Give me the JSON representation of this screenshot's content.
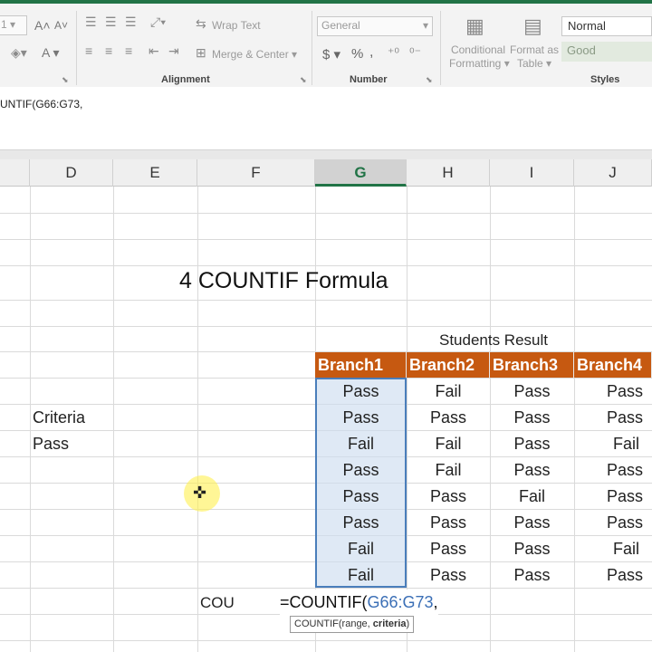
{
  "ribbon": {
    "wrap_text": "Wrap Text",
    "merge_center": "Merge & Center",
    "number_format": "General",
    "currency": "$",
    "percent": "%",
    "comma": ",",
    "conditional_formatting": [
      "Conditional",
      "Formatting"
    ],
    "format_as_table": [
      "Format as",
      "Table"
    ],
    "style_normal": "Normal",
    "style_good": "Good",
    "group_alignment": "Alignment",
    "group_number": "Number",
    "group_styles": "Styles",
    "font_grow": "A",
    "font_shrink": "A",
    "font_color": "A",
    "font_size_value": "1"
  },
  "formula_bar": {
    "text": "UNTIF(G66:G73,"
  },
  "columns": [
    "D",
    "E",
    "F",
    "G",
    "H",
    "I",
    "J"
  ],
  "title": "4 COUNTIF Formula",
  "table": {
    "caption": "Students Result",
    "headers": [
      "Branch1",
      "Branch2",
      "Branch3",
      "Branch4"
    ],
    "rows": [
      [
        "Pass",
        "Fail",
        "Pass",
        "Pass"
      ],
      [
        "Pass",
        "Pass",
        "Pass",
        "Pass"
      ],
      [
        "Fail",
        "Fail",
        "Pass",
        "Fail"
      ],
      [
        "Pass",
        "Fail",
        "Pass",
        "Pass"
      ],
      [
        "Pass",
        "Pass",
        "Fail",
        "Pass"
      ],
      [
        "Pass",
        "Pass",
        "Pass",
        "Pass"
      ],
      [
        "Fail",
        "Pass",
        "Pass",
        "Fail"
      ],
      [
        "Fail",
        "Pass",
        "Pass",
        "Pass"
      ]
    ]
  },
  "criteria": {
    "label": "Criteria",
    "value": "Pass"
  },
  "cou_label": "COU",
  "formula_edit": {
    "prefix": "=COUNTIF(",
    "ref": "G66:G73",
    "suffix": ","
  },
  "tooltip": {
    "fn": "COUNTIF(range, ",
    "arg": "criteria",
    "close": ")"
  },
  "colors": {
    "header_fill": "#c65911",
    "selection": "#4a7ebb",
    "accent": "#217346"
  }
}
